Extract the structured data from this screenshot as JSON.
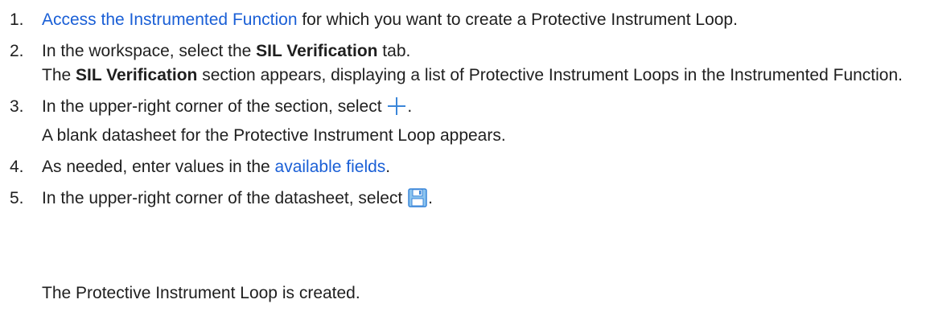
{
  "steps": [
    {
      "num": "1.",
      "link_text": "Access the Instrumented Function",
      "text_after": " for which you want to create a Protective Instrument Loop."
    },
    {
      "num": "2.",
      "text_before": "In the workspace, select the ",
      "bold_text": "SIL Verification",
      "text_after": " tab.",
      "result_bold": "SIL Verification",
      "result_before": "The ",
      "result_after": " section appears, displaying a list of Protective Instrument Loops in the Instrumented Function."
    },
    {
      "num": "3.",
      "text_before": "In the upper-right corner of the section, select ",
      "icon": "plus-icon",
      "text_after": ".",
      "result": "A blank datasheet for the Protective Instrument Loop appears."
    },
    {
      "num": "4.",
      "text_before": "As needed, enter values in the ",
      "link_text": "available fields",
      "text_after": "."
    },
    {
      "num": "5.",
      "text_before": "In the upper-right corner of the datasheet, select ",
      "icon": "save-icon",
      "text_after": "."
    }
  ],
  "final_result": "The Protective Instrument Loop is created.",
  "colors": {
    "link": "#1a5fd6",
    "icon_blue": "#3a86d9",
    "save_fill": "#8cc4ef"
  }
}
